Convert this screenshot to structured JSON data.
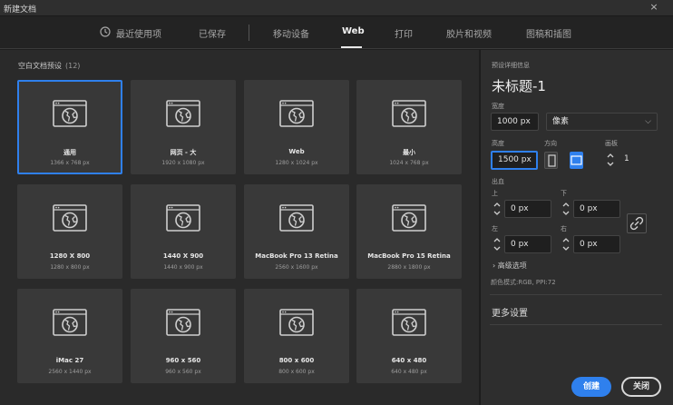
{
  "window": {
    "title": "新建文档",
    "close_label": "×"
  },
  "tabs": [
    {
      "label": "最近使用项",
      "icon": "clock-icon"
    },
    {
      "label": "已保存"
    },
    {
      "label": "移动设备"
    },
    {
      "label": "Web",
      "active": true
    },
    {
      "label": "打印"
    },
    {
      "label": "胶片和视频"
    },
    {
      "label": "图稿和插图"
    }
  ],
  "presets": {
    "heading": "空白文档预设",
    "count": "(12)",
    "items": [
      {
        "name": "通用",
        "size": "1366 x 768 px",
        "selected": true
      },
      {
        "name": "网页 - 大",
        "size": "1920 x 1080 px"
      },
      {
        "name": "Web",
        "size": "1280 x 1024 px"
      },
      {
        "name": "最小",
        "size": "1024 x 768 px"
      },
      {
        "name": "1280 X 800",
        "size": "1280 x 800 px"
      },
      {
        "name": "1440 X 900",
        "size": "1440 x 900 px"
      },
      {
        "name": "MacBook Pro 13 Retina",
        "size": "2560 x 1600 px"
      },
      {
        "name": "MacBook Pro 15 Retina",
        "size": "2880 x 1800 px"
      },
      {
        "name": "iMac 27",
        "size": "2560 x 1440 px"
      },
      {
        "name": "960 x 560",
        "size": "960 x 560 px"
      },
      {
        "name": "800 x 600",
        "size": "800 x 600 px"
      },
      {
        "name": "640 x 480",
        "size": "640 x 480 px"
      }
    ]
  },
  "details": {
    "section_label": "预设详细信息",
    "doc_title": "未标题-1",
    "width_label": "宽度",
    "width_value": "1000 px",
    "unit_value": "像素",
    "height_label": "高度",
    "height_value": "1500 px",
    "orientation_label": "方向",
    "artboards_label": "画板",
    "artboards_value": "1",
    "bleed_label": "出血",
    "top_label": "上",
    "top_value": "0 px",
    "bottom_label": "下",
    "bottom_value": "0 px",
    "left_label": "左",
    "left_value": "0 px",
    "right_label": "右",
    "right_value": "0 px",
    "advanced_label": "高级选项",
    "color_mode_text": "颜色模式:RGB, PPI:72",
    "more_settings": "更多设置",
    "create_label": "创建",
    "close_label": "关闭"
  },
  "colors": {
    "accent": "#2f80ed",
    "panel": "#2a2a2a",
    "card": "#393939"
  }
}
